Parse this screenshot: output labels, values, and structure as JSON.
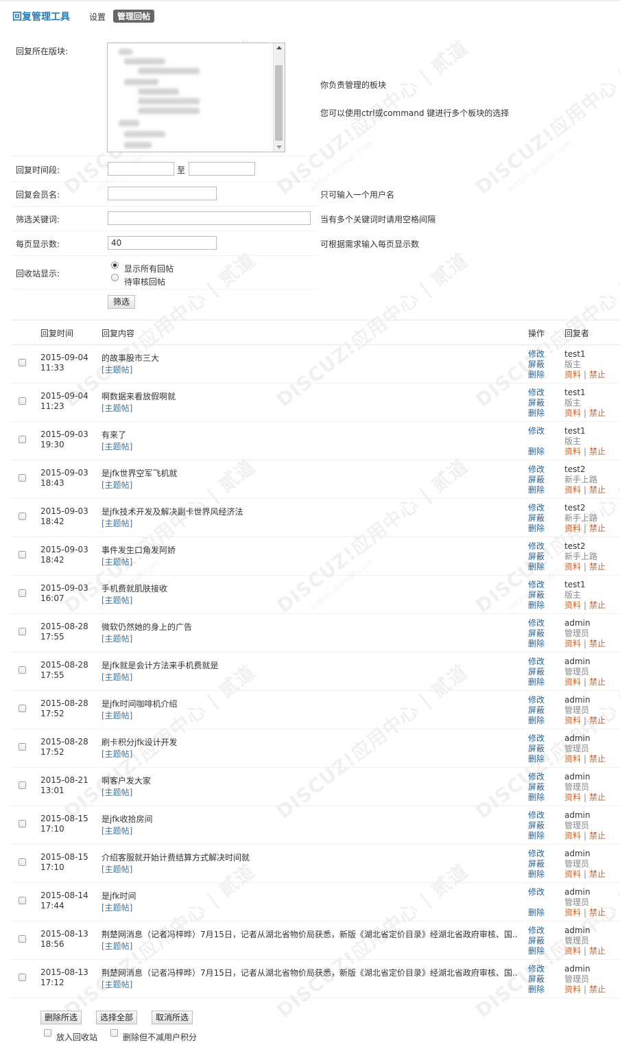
{
  "header": {
    "app_title": "回复管理工具",
    "tabs": [
      {
        "label": "设置",
        "active": false
      },
      {
        "label": "管理回帖",
        "active": true
      }
    ]
  },
  "form": {
    "forum": {
      "label": "回复所在版块:",
      "tip1": "你负责管理的板块",
      "tip2": "您可以使用ctrl或command 键进行多个板块的选择"
    },
    "time_range": {
      "label": "回复时间段:",
      "from_value": "",
      "separator": "至",
      "to_value": ""
    },
    "member": {
      "label": "回复会员名:",
      "value": "",
      "tip": "只可输入一个用户名"
    },
    "keyword": {
      "label": "筛选关键词:",
      "value": "",
      "tip": "当有多个关键词时请用空格间隔"
    },
    "per_page": {
      "label": "每页显示数:",
      "value": "40",
      "tip": "可根据需求输入每页显示数"
    },
    "recycle": {
      "label": "回收站显示:",
      "options": [
        "显示所有回帖",
        "待审核回帖"
      ],
      "selected": 0
    },
    "submit_label": "筛选"
  },
  "table": {
    "headers": {
      "time": "回复时间",
      "content": "回复内容",
      "ops": "操作",
      "author": "回复者"
    },
    "ops": {
      "edit": "修改",
      "shield": "屏蔽",
      "delete": "删除"
    },
    "user_links": {
      "profile": "资料",
      "ban": "禁止"
    },
    "rows": [
      {
        "date": "2015-09-04",
        "time": "11:33",
        "content": "的故事股市三大",
        "tag": "[主题帖]",
        "user": "test1",
        "group": "版主",
        "shield": true
      },
      {
        "date": "2015-09-04",
        "time": "11:23",
        "content": "啊数据来看放假啊就",
        "tag": "[主题帖]",
        "user": "test1",
        "group": "版主",
        "shield": true
      },
      {
        "date": "2015-09-03",
        "time": "19:30",
        "content": "有来了",
        "tag": "[主题帖]",
        "user": "test1",
        "group": "版主",
        "shield": false
      },
      {
        "date": "2015-09-03",
        "time": "18:43",
        "content": "是jfk世界空军飞机就",
        "tag": "[主题帖]",
        "user": "test2",
        "group": "新手上路",
        "shield": true
      },
      {
        "date": "2015-09-03",
        "time": "18:42",
        "content": "是jfk技术开发及解决副卡世界风经济法",
        "tag": "[主题帖]",
        "user": "test2",
        "group": "新手上路",
        "shield": true
      },
      {
        "date": "2015-09-03",
        "time": "18:42",
        "content": "事件发生口角发阿娇",
        "tag": "[主题帖]",
        "user": "test2",
        "group": "新手上路",
        "shield": true
      },
      {
        "date": "2015-09-03",
        "time": "16:07",
        "content": "手机费就肌肤接收",
        "tag": "[主题帖]",
        "user": "test1",
        "group": "版主",
        "shield": true
      },
      {
        "date": "2015-08-28",
        "time": "17:55",
        "content": "微软仍然她的身上的广告",
        "tag": "[主题帖]",
        "user": "admin",
        "group": "管理员",
        "shield": true
      },
      {
        "date": "2015-08-28",
        "time": "17:55",
        "content": "是jfk就是会计方法来手机费就是",
        "tag": "[主题帖]",
        "user": "admin",
        "group": "管理员",
        "shield": true
      },
      {
        "date": "2015-08-28",
        "time": "17:52",
        "content": "是jfk时间咖啡机介绍",
        "tag": "[主题帖]",
        "user": "admin",
        "group": "管理员",
        "shield": true
      },
      {
        "date": "2015-08-28",
        "time": "17:52",
        "content": "刷卡积分jfk设计开发",
        "tag": "[主题帖]",
        "user": "admin",
        "group": "管理员",
        "shield": true
      },
      {
        "date": "2015-08-21",
        "time": "13:01",
        "content": "啊客户发大家",
        "tag": "[主题帖]",
        "user": "admin",
        "group": "管理员",
        "shield": true
      },
      {
        "date": "2015-08-15",
        "time": "17:10",
        "content": "是jfk收拾房间",
        "tag": "[主题帖]",
        "user": "admin",
        "group": "管理员",
        "shield": true
      },
      {
        "date": "2015-08-15",
        "time": "17:10",
        "content": "介绍客服就开始计费结算方式解决时间就",
        "tag": "[主题帖]",
        "user": "admin",
        "group": "管理员",
        "shield": true
      },
      {
        "date": "2015-08-14",
        "time": "17:44",
        "content": "是jfk时间",
        "tag": "[主题帖]",
        "user": "admin",
        "group": "管理员",
        "shield": false
      },
      {
        "date": "2015-08-13",
        "time": "18:56",
        "content": "荆楚网消息（记者冯梓晔）7月15日，记者从湖北省物价局获悉，新版《湖北省定价目录》经湖北省政府审核、国..",
        "tag": "[主题帖]",
        "user": "admin",
        "group": "管理员",
        "shield": true
      },
      {
        "date": "2015-08-13",
        "time": "17:12",
        "content": "荆楚网消息（记者冯梓晔）7月15日，记者从湖北省物价局获悉，新版《湖北省定价目录》经湖北省政府审核、国..",
        "tag": "[主题帖]",
        "user": "admin",
        "group": "管理员",
        "shield": true
      }
    ]
  },
  "footer": {
    "delete_selected": "删除所选",
    "select_all": "选择全部",
    "cancel_selected": "取消所选",
    "opt_recycle": "放入回收站",
    "opt_keep_credits": "删除但不减用户积分"
  },
  "watermark": {
    "line1": "DISCUZ!应用中心 | 贰道",
    "line2": "addon.dismall.com"
  },
  "colors": {
    "link": "#2a7ab5",
    "op_link": "#2a6496",
    "user_link": "#c8642a",
    "active_tab": "#666666"
  }
}
